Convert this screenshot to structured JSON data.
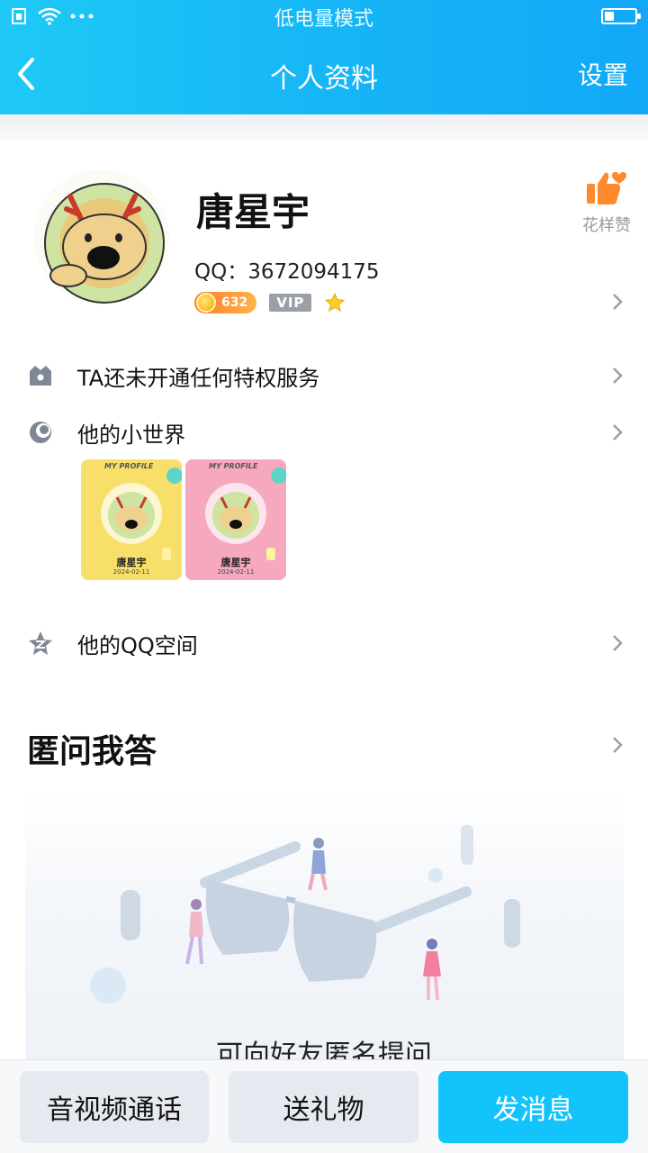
{
  "status_bar": {
    "center_text": "低电量模式"
  },
  "nav": {
    "title": "个人资料",
    "right_label": "设置"
  },
  "profile": {
    "name": "唐星宇",
    "qq_line": "QQ：3672094175",
    "coin_level": "632",
    "vip_label": "VIP"
  },
  "like": {
    "label": "花样赞"
  },
  "rows": [
    {
      "label": "TA还未开通任何特权服务"
    },
    {
      "label": "他的小世界"
    },
    {
      "label": "他的QQ空间"
    }
  ],
  "cards": [
    {
      "header": "MY PROFILE",
      "name": "唐星宇",
      "date": "2024-02-11",
      "color": "#f8df6a"
    },
    {
      "header": "MY PROFILE",
      "name": "唐星宇",
      "date": "2024-02-11",
      "color": "#f6a8bf"
    }
  ],
  "section": {
    "title": "匿问我答",
    "illustration_caption": "可向好友匿名提问"
  },
  "bottom_bar": {
    "call": "音视频通话",
    "gift": "送礼物",
    "message": "发消息"
  },
  "colors": {
    "header": "#18b8f7",
    "primary_button": "#12c4fb",
    "grey_button": "#e6e9ef"
  }
}
